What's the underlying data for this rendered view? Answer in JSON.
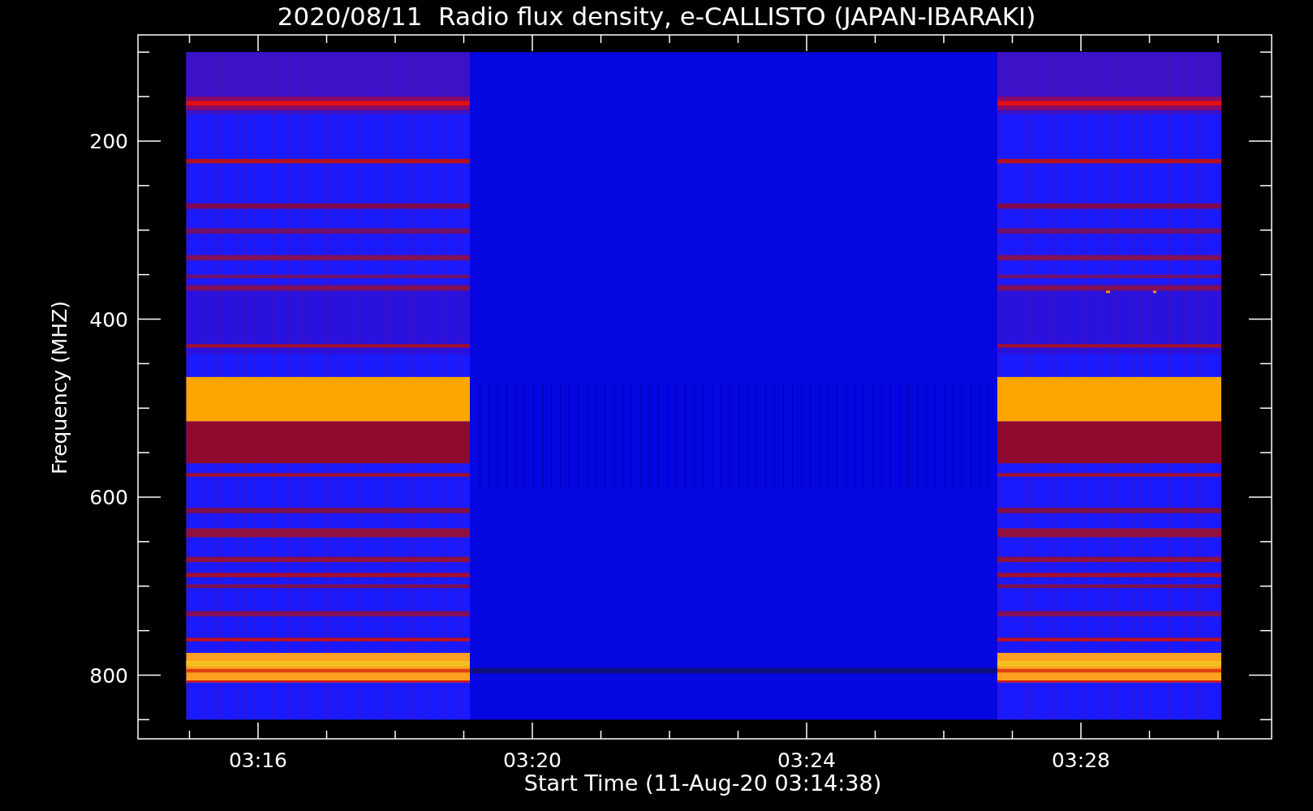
{
  "plot": {
    "title": "2020/08/11  Radio flux density, e-CALLISTO (JAPAN-IBARAKI)",
    "xlabel": "Start Time (11-Aug-20 03:14:38)",
    "ylabel": "Frequency (MHZ)",
    "x_tick_labels": [
      "03:16",
      "03:20",
      "03:24",
      "03:28"
    ],
    "y_tick_labels": [
      "200",
      "400",
      "600",
      "800"
    ]
  }
}
